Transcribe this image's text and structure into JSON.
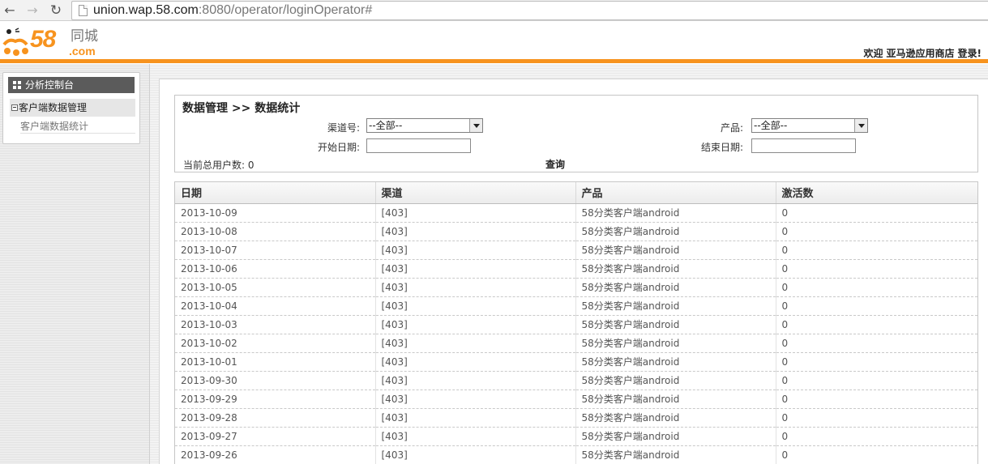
{
  "browser": {
    "url_host": "union.wap.58.com",
    "url_path": ":8080/operator/loginOperator#"
  },
  "header": {
    "logo_number": "58",
    "logo_cn": "同城",
    "logo_com": ".com",
    "welcome": "欢迎",
    "user": "亚马逊应用商店",
    "login": "登录!"
  },
  "sidebar": {
    "title": "分析控制台",
    "group": "客户端数据管理",
    "item": "客户端数据统计"
  },
  "search": {
    "breadcrumb": "数据管理 >> 数据统计",
    "channel_label": "渠道号:",
    "channel_value": "--全部--",
    "product_label": "产品:",
    "product_value": "--全部--",
    "start_label": "开始日期:",
    "end_label": "结束日期:",
    "total_label": "当前总用户数:",
    "total_value": "0",
    "query_label": "查询"
  },
  "table": {
    "headers": [
      "日期",
      "渠道",
      "产品",
      "激活数"
    ],
    "rows": [
      [
        "2013-10-09",
        "[403]",
        "58分类客户端android",
        "0"
      ],
      [
        "2013-10-08",
        "[403]",
        "58分类客户端android",
        "0"
      ],
      [
        "2013-10-07",
        "[403]",
        "58分类客户端android",
        "0"
      ],
      [
        "2013-10-06",
        "[403]",
        "58分类客户端android",
        "0"
      ],
      [
        "2013-10-05",
        "[403]",
        "58分类客户端android",
        "0"
      ],
      [
        "2013-10-04",
        "[403]",
        "58分类客户端android",
        "0"
      ],
      [
        "2013-10-03",
        "[403]",
        "58分类客户端android",
        "0"
      ],
      [
        "2013-10-02",
        "[403]",
        "58分类客户端android",
        "0"
      ],
      [
        "2013-10-01",
        "[403]",
        "58分类客户端android",
        "0"
      ],
      [
        "2013-09-30",
        "[403]",
        "58分类客户端android",
        "0"
      ],
      [
        "2013-09-29",
        "[403]",
        "58分类客户端android",
        "0"
      ],
      [
        "2013-09-28",
        "[403]",
        "58分类客户端android",
        "0"
      ],
      [
        "2013-09-27",
        "[403]",
        "58分类客户端android",
        "0"
      ],
      [
        "2013-09-26",
        "[403]",
        "58分类客户端android",
        "0"
      ]
    ]
  },
  "colors": {
    "brand_orange": "#f7931e",
    "sidebar_title_bg": "#5b5b5b"
  },
  "icons": {
    "back": "back-arrow-icon",
    "forward": "forward-arrow-icon",
    "reload": "reload-icon",
    "page": "page-icon",
    "dashboard": "grid-icon",
    "collapse": "minus-box-icon",
    "dropdown": "dropdown-arrow-icon"
  }
}
